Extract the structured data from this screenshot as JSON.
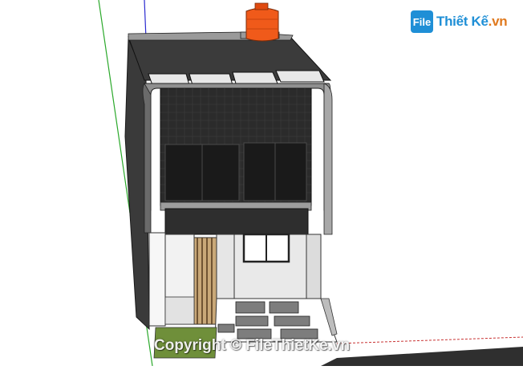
{
  "viewport": {
    "description_role": "3d-model-view"
  },
  "logo": {
    "mark": "File",
    "text_main": "Thiết Kế",
    "text_suffix": ".vn"
  },
  "watermark": {
    "text": "Copyright © FileThietKe.vn"
  },
  "colors": {
    "background": "#ffffff",
    "wall_dark": "#2b2b2b",
    "wall_grey": "#8a8a8a",
    "tank_orange": "#f05a1a",
    "grass": "#6f8f3a",
    "axis_green": "#2aa82a",
    "axis_blue": "#2a2ad0",
    "axis_red": "#c83232"
  }
}
